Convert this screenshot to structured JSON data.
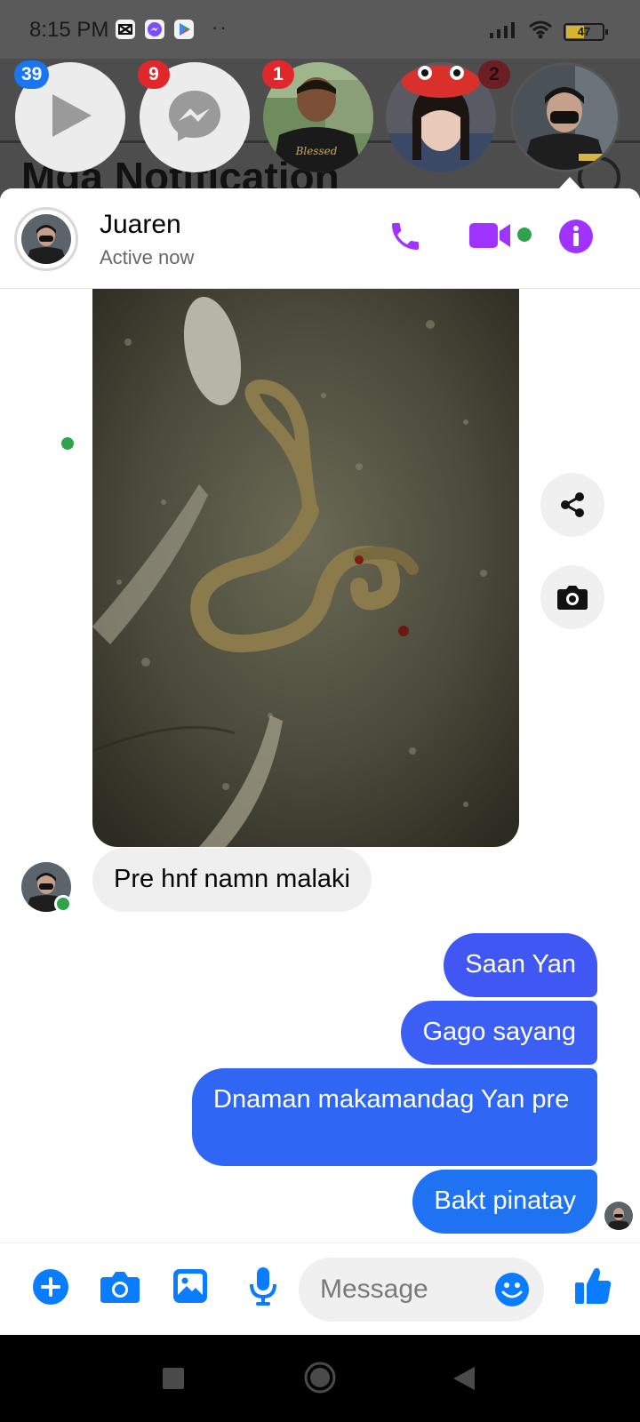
{
  "status_bar": {
    "time": "8:15 PM",
    "dots": "··",
    "battery": "47"
  },
  "background": {
    "title": "Mga Notification"
  },
  "chat_heads": [
    {
      "kind": "video-app",
      "badge": "39"
    },
    {
      "kind": "messenger",
      "badge": "9"
    },
    {
      "kind": "contact",
      "badge": "1",
      "shirt_text": "Blessed"
    },
    {
      "kind": "contact",
      "badge": ""
    },
    {
      "kind": "contact",
      "badge": "2"
    }
  ],
  "header": {
    "name": "Juaren",
    "status": "Active now"
  },
  "messages": [
    {
      "from": "them",
      "text": "Pre hnf namn malaki"
    },
    {
      "from": "me",
      "text": "Saan Yan"
    },
    {
      "from": "me",
      "text": "Gago sayang"
    },
    {
      "from": "me",
      "text": "Dnaman makamandag Yan pre"
    },
    {
      "from": "me",
      "text": "Bakt pinatay"
    }
  ],
  "composer": {
    "placeholder": "Message"
  },
  "colors": {
    "accent_purple": "#a033ff",
    "accent_blue": "#0a7cff",
    "bubble_top": "#3b5cf6",
    "bubble_bottom": "#1f73f3",
    "online": "#31a24c"
  }
}
